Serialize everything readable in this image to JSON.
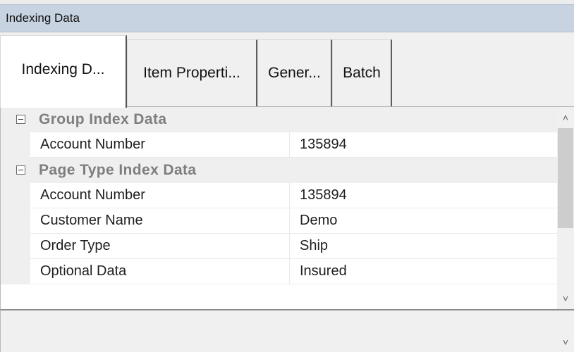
{
  "panel": {
    "title": "Indexing Data"
  },
  "tabs": [
    {
      "label": "Indexing D...",
      "active": true
    },
    {
      "label": "Item Properti...",
      "active": false
    },
    {
      "label": "Gener...",
      "active": false
    },
    {
      "label": "Batch",
      "active": false
    }
  ],
  "grid": {
    "groups": [
      {
        "label": "Group Index Data",
        "expanded": true,
        "properties": [
          {
            "name": "Account Number",
            "value": "135894"
          }
        ]
      },
      {
        "label": "Page Type Index Data",
        "expanded": true,
        "properties": [
          {
            "name": "Account Number",
            "value": "135894"
          },
          {
            "name": "Customer Name",
            "value": "Demo"
          },
          {
            "name": "Order Type",
            "value": "Ship"
          },
          {
            "name": "Optional Data",
            "value": "Insured"
          }
        ]
      }
    ]
  },
  "scrollbar": {
    "up_icon": "chevron-up-icon",
    "down_icon": "chevron-down-icon"
  },
  "description": {
    "text": ""
  },
  "colors": {
    "title_bar": "#c7d3e1",
    "category_text": "#7e7e7e",
    "grid_gutter": "#efefef",
    "scroll_thumb": "#cdcdcd"
  }
}
